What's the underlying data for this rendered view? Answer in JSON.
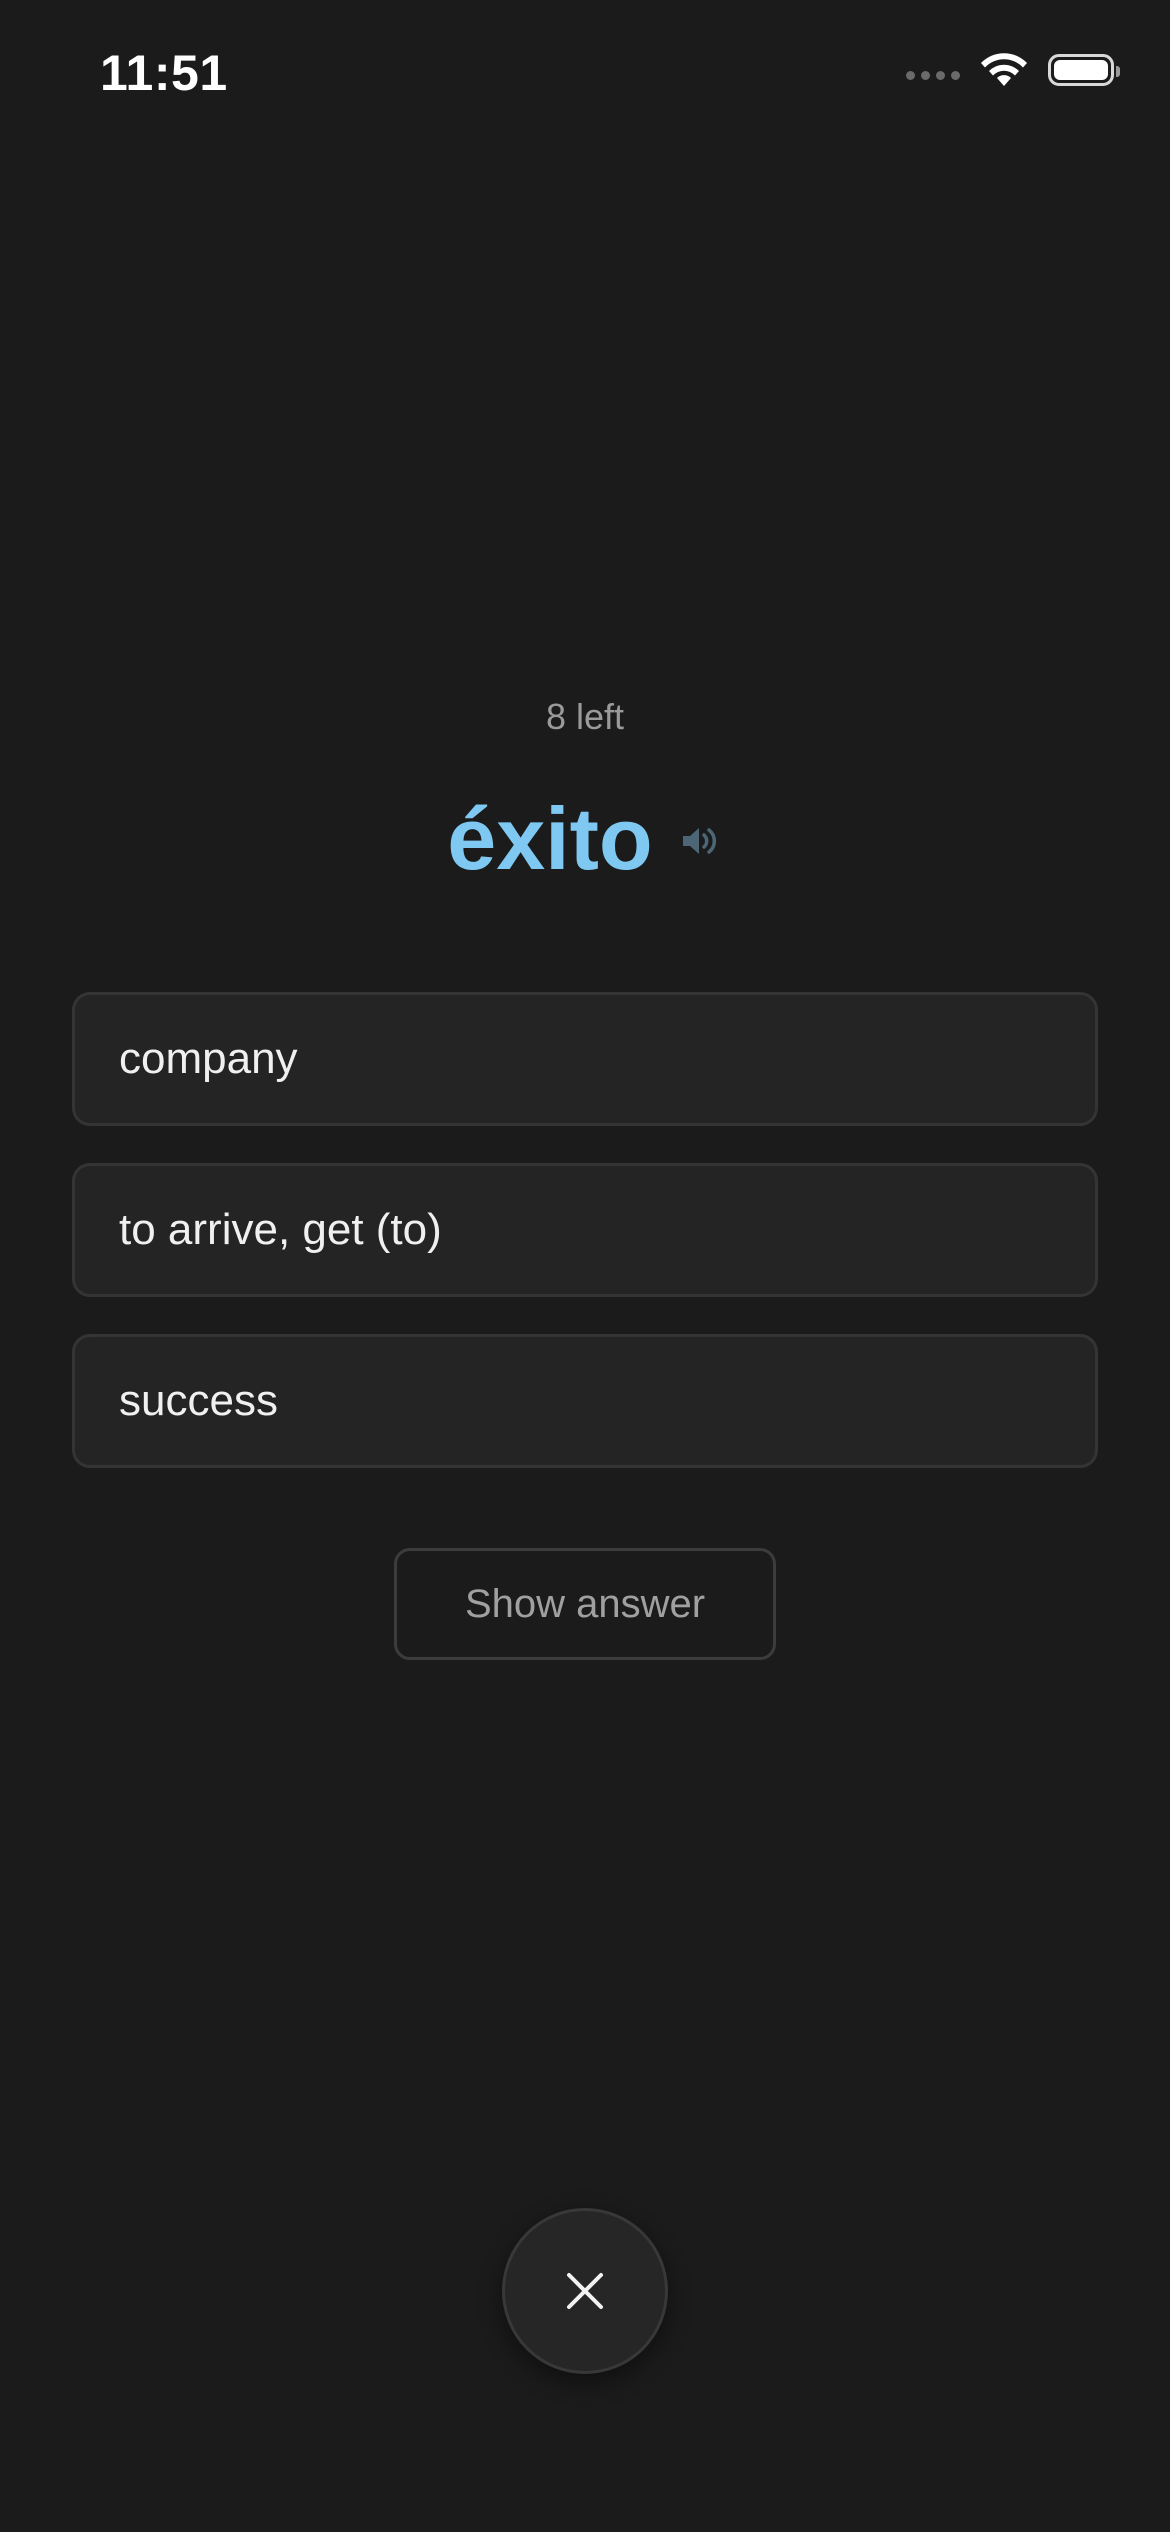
{
  "status_bar": {
    "time": "11:51",
    "icons": [
      "cellular-dots-icon",
      "wifi-icon",
      "battery-icon"
    ]
  },
  "quiz": {
    "remaining_label": "8 left",
    "word": "éxito",
    "word_color": "#7ec8f2",
    "speaker_icon": "speaker-icon",
    "options": [
      {
        "label": "company"
      },
      {
        "label": "to arrive, get (to)"
      },
      {
        "label": "success"
      }
    ],
    "show_answer_label": "Show answer",
    "close_icon": "close-icon"
  }
}
